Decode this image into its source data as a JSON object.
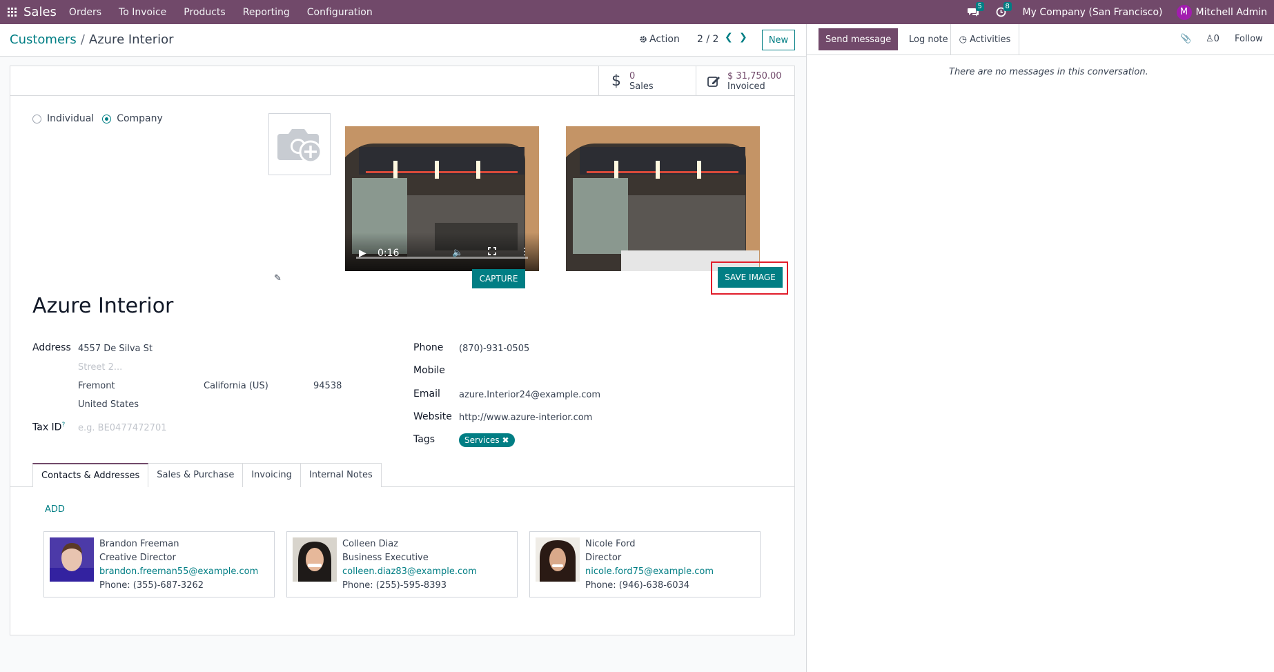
{
  "navbar": {
    "app_name": "Sales",
    "menu": [
      "Orders",
      "To Invoice",
      "Products",
      "Reporting",
      "Configuration"
    ],
    "messages_badge": "5",
    "activities_badge": "8",
    "company": "My Company (San Francisco)",
    "user_initial": "M",
    "user_name": "Mitchell Admin"
  },
  "control": {
    "breadcrumb_parent": "Customers",
    "breadcrumb_separator": "/",
    "breadcrumb_current": "Azure Interior",
    "action_label": "Action",
    "pager": "2 / 2",
    "new_label": "New"
  },
  "stats": {
    "sales_value": "0",
    "sales_label": "Sales",
    "invoiced_value": "$ 31,750.00",
    "invoiced_label": "Invoiced"
  },
  "type_options": {
    "individual": "Individual",
    "company": "Company",
    "selected": "company"
  },
  "webcam": {
    "time": "0:16",
    "capture_label": "CAPTURE",
    "save_label": "SAVE IMAGE"
  },
  "partner": {
    "name": "Azure Interior",
    "address_label": "Address",
    "street": "4557 De Silva St",
    "street2_placeholder": "Street 2...",
    "city": "Fremont",
    "state": "California (US)",
    "zip": "94538",
    "country": "United States",
    "tax_label": "Tax ID",
    "tax_help": "?",
    "tax_placeholder": "e.g. BE0477472701",
    "phone_label": "Phone",
    "phone": "(870)-931-0505",
    "mobile_label": "Mobile",
    "email_label": "Email",
    "email": "azure.Interior24@example.com",
    "website_label": "Website",
    "website": "http://www.azure-interior.com",
    "tags_label": "Tags",
    "tag": "Services"
  },
  "tabs": [
    "Contacts & Addresses",
    "Sales & Purchase",
    "Invoicing",
    "Internal Notes"
  ],
  "contacts": {
    "add_label": "ADD",
    "items": [
      {
        "name": "Brandon Freeman",
        "role": "Creative Director",
        "email": "brandon.freeman55@example.com",
        "phone": "Phone: (355)-687-3262"
      },
      {
        "name": "Colleen Diaz",
        "role": "Business Executive",
        "email": "colleen.diaz83@example.com",
        "phone": "Phone: (255)-595-8393"
      },
      {
        "name": "Nicole Ford",
        "role": "Director",
        "email": "nicole.ford75@example.com",
        "phone": "Phone: (946)-638-6034"
      }
    ]
  },
  "chatter": {
    "send_message": "Send message",
    "log_note": "Log note",
    "activities": "Activities",
    "followers_count": "0",
    "follow": "Follow",
    "empty": "There are no messages in this conversation."
  },
  "colors": {
    "primary": "#71496a",
    "accent": "#017e84",
    "highlight": "#e11d2a"
  }
}
